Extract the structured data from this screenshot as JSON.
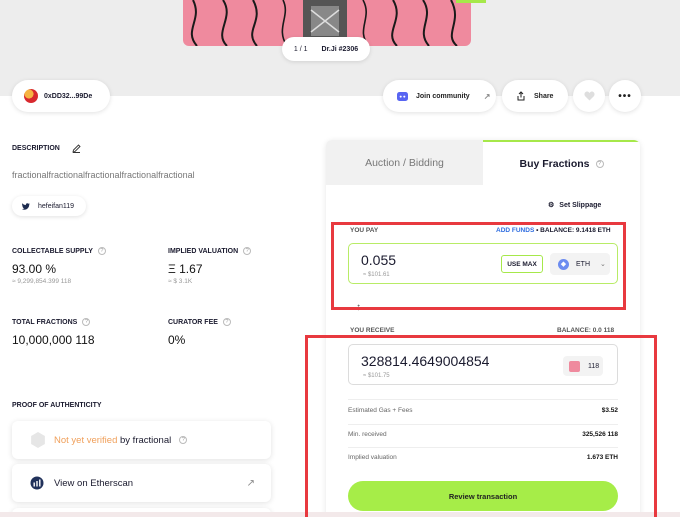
{
  "hero": {
    "counter": "1 / 1",
    "nft_name": "Dr.Ji #2306"
  },
  "owner": {
    "address": "0xDD32...99De"
  },
  "actions": {
    "join_community": "Join community",
    "share": "Share",
    "more": "•••"
  },
  "description": {
    "title": "DESCRIPTION",
    "text": "fractionalfractionalfractionalfractionalfractional",
    "twitter_handle": "hefeifan119"
  },
  "stats": {
    "collectable_supply": {
      "label": "COLLECTABLE SUPPLY",
      "value": "93.00 %",
      "sub": "≈ 9,299,854.399 118"
    },
    "implied_valuation": {
      "label": "IMPLIED VALUATION",
      "value": "Ξ 1.67",
      "sub": "≈ $ 3.1K"
    },
    "total_fractions": {
      "label": "TOTAL FRACTIONS",
      "value": "10,000,000 118"
    },
    "curator_fee": {
      "label": "CURATOR FEE",
      "value": "0%"
    }
  },
  "proof": {
    "title": "PROOF OF AUTHENTICITY",
    "verify_prefix": "Not yet verified",
    "verify_suffix": " by fractional",
    "etherscan": "View on Etherscan"
  },
  "panel": {
    "tab_auction": "Auction / Bidding",
    "tab_buy": "Buy Fractions",
    "slippage": "Set Slippage",
    "pay": {
      "label": "YOU PAY",
      "add_funds": "ADD FUNDS",
      "balance": "• BALANCE: 9.1418 ETH",
      "amount": "0.055",
      "usd": "≈ $101.61",
      "use_max": "USE MAX",
      "token": "ETH"
    },
    "receive": {
      "label": "YOU RECEIVE",
      "balance": "BALANCE: 0.0 118",
      "amount": "328814.4649004854",
      "usd": "≈ $101.75",
      "token": "118"
    },
    "fees": [
      {
        "key": "Estimated Gas + Fees",
        "value": "$3.52"
      },
      {
        "key": "Min. received",
        "value": "325,526 118"
      },
      {
        "key": "Implied valuation",
        "value": "1.673 ETH"
      }
    ],
    "review_button": "Review transaction"
  },
  "colors": {
    "accent_green": "#a6ed48",
    "link_blue": "#2f6de0",
    "highlight_red": "#e8393f",
    "warning_orange": "#f0a05b"
  }
}
